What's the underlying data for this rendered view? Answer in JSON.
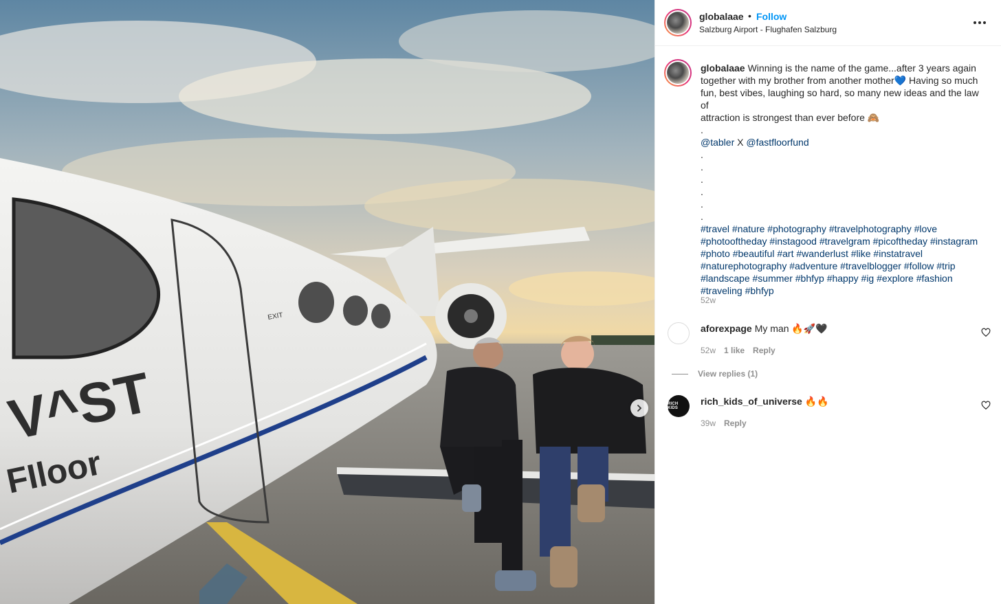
{
  "post": {
    "username": "globalaae",
    "follow_label": "Follow",
    "dot": "•",
    "location": "Salzburg Airport - Flughafen Salzburg",
    "caption": {
      "username": "globalaae",
      "line1": "Winning is the name of the game...after 3 years again",
      "line2": "together with my brother from another mother💙 Having so much",
      "line3": "fun, best vibes, laughing so hard, so many new ideas and the law of",
      "line4": "attraction is strongest than ever before 🙈",
      "dot": ".",
      "mention1": "@tabler",
      "mention_sep": " X ",
      "mention2": "@fastfloorfund"
    },
    "hashtags": [
      [
        "#travel",
        "#nature",
        "#photography",
        "#travelphotography",
        "#love"
      ],
      [
        "#photooftheday",
        "#instagood",
        "#travelgram",
        "#picoftheday",
        "#instagram"
      ],
      [
        "#photo",
        "#beautiful",
        "#art",
        "#wanderlust",
        "#like",
        "#instatravel"
      ],
      [
        "#naturephotography",
        "#adventure",
        "#travelblogger",
        "#follow",
        "#trip"
      ],
      [
        "#landscape",
        "#summer",
        "#bhfyp",
        "#happy",
        "#ig",
        "#explore",
        "#fashion"
      ],
      [
        "#traveling",
        "#bhfyp"
      ]
    ],
    "time": "52w"
  },
  "photo": {
    "plane_text_line1": "V^ST",
    "plane_text_line2": "FIloor",
    "exit_text": "EXIT"
  },
  "comments": [
    {
      "username": "aforexpage",
      "text": "My man 🔥🚀🖤",
      "time": "52w",
      "likes": "1 like",
      "reply": "Reply",
      "view_replies": "View replies (1)"
    },
    {
      "username": "rich_kids_of_universe",
      "text": "🔥🔥",
      "time": "39w",
      "reply": "Reply",
      "avatar_text": "RICH KIDS"
    }
  ],
  "icons": {
    "more": "more-horizontal-icon",
    "next": "chevron-right-icon",
    "heart": "heart-outline-icon"
  }
}
